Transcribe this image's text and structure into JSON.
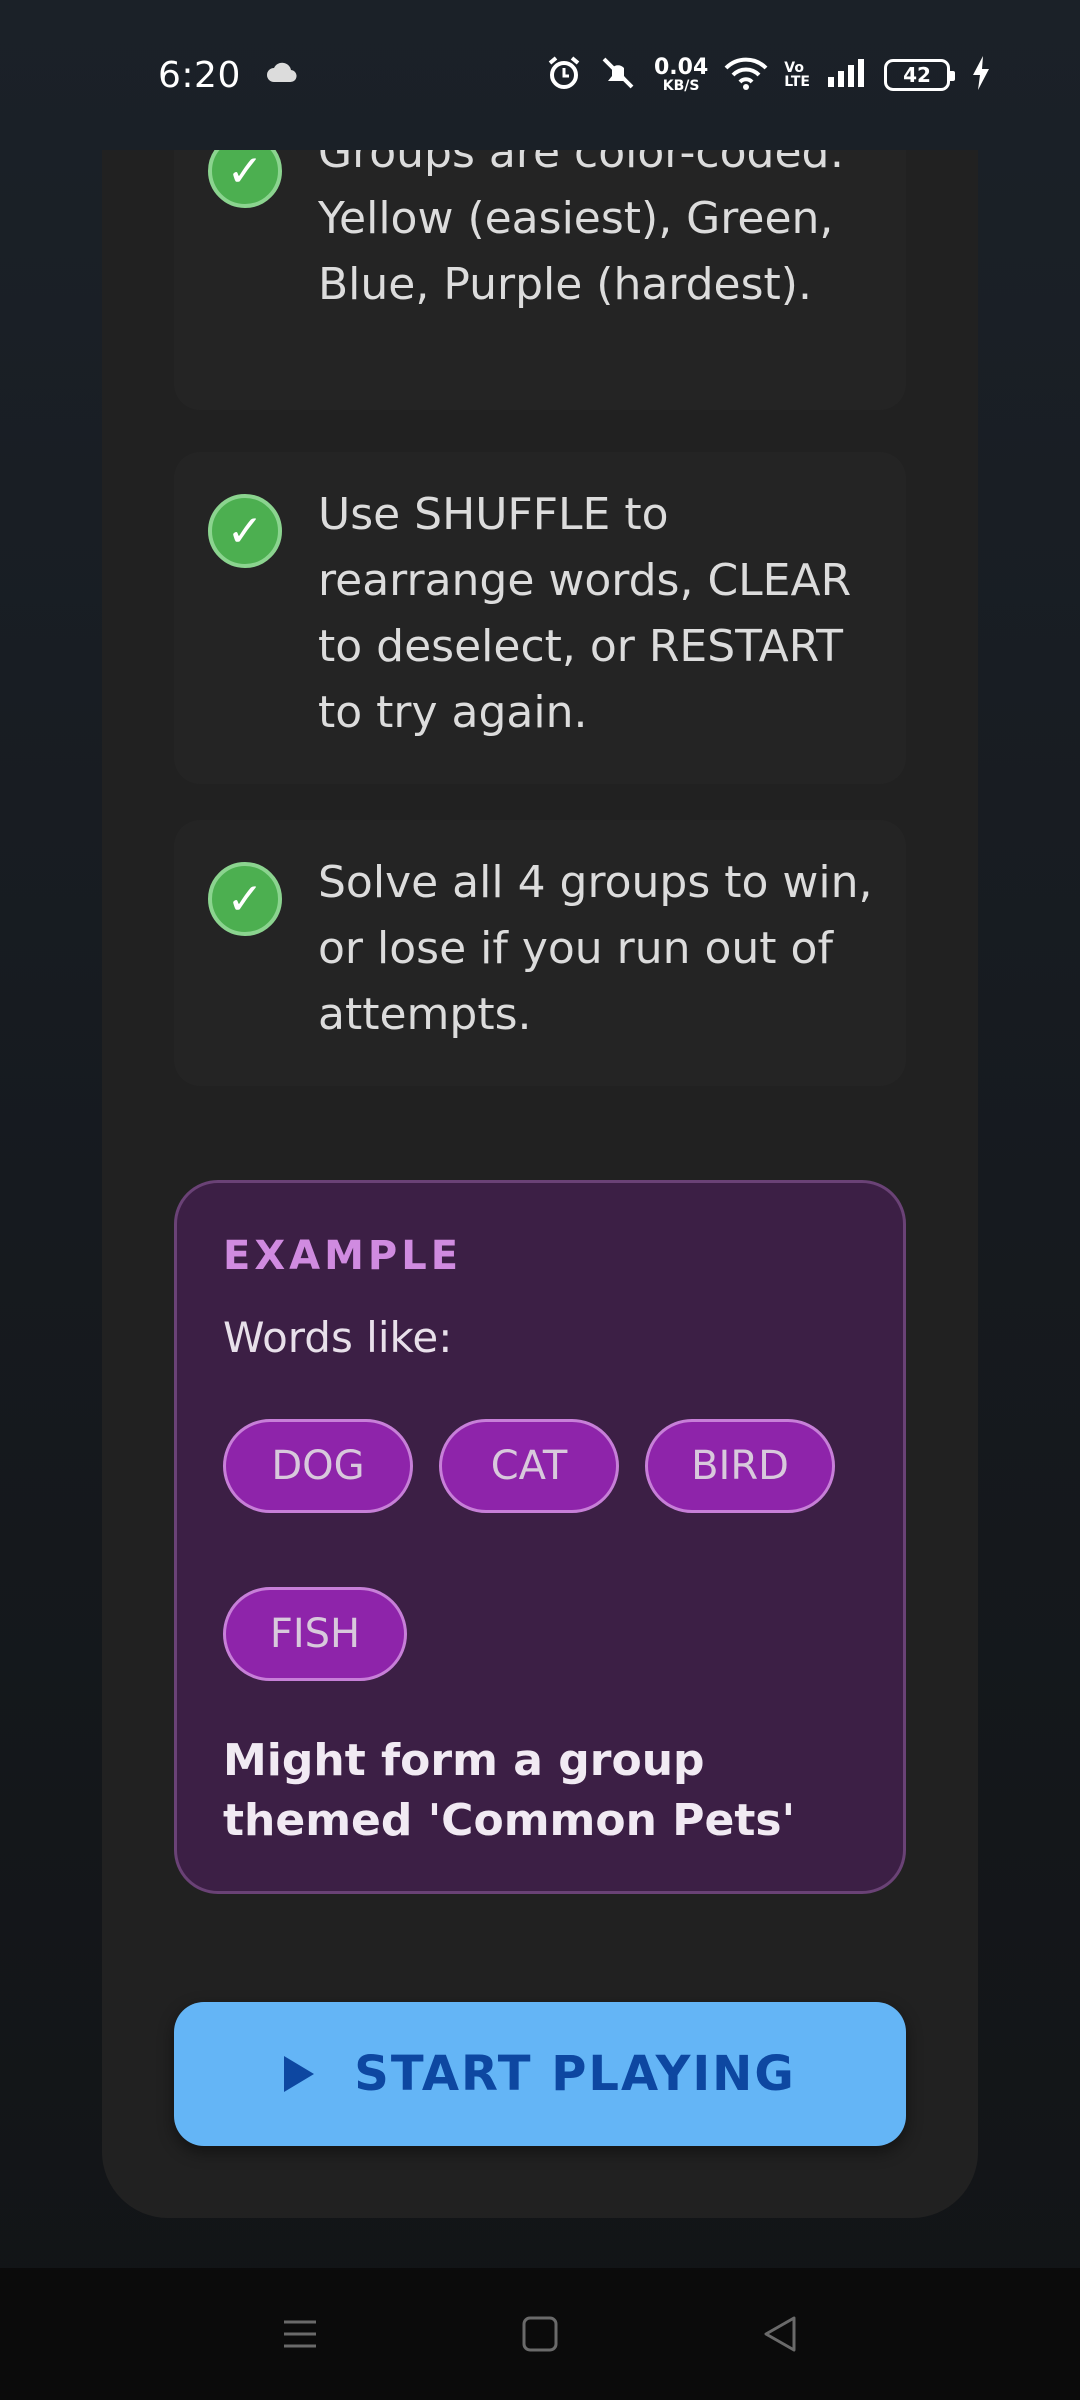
{
  "status_bar": {
    "time": "6:20",
    "net_speed_value": "0.04",
    "net_speed_unit": "KB/S",
    "volte_top": "Vo",
    "volte_bottom": "LTE",
    "battery": "42"
  },
  "rules": [
    {
      "text": "Groups are color-coded: Yellow (easiest), Green, Blue, Purple (hardest)."
    },
    {
      "text": "Use SHUFFLE to rearrange words, CLEAR to deselect, or RESTART to try again."
    },
    {
      "text": "Solve all 4 groups to win, or lose if you run out of attempts."
    }
  ],
  "example": {
    "title": "EXAMPLE",
    "subtitle": "Words like:",
    "words": [
      "DOG",
      "CAT",
      "BIRD",
      "FISH"
    ],
    "note": "Might form a group themed 'Common Pets'"
  },
  "start_button": {
    "label": "START PLAYING"
  },
  "colors": {
    "accent_blue": "#64b5f6",
    "check_green": "#4caf50",
    "chip_purple": "#8e24aa",
    "example_bg": "#3c1f45"
  },
  "icons": [
    "weather-cloud-icon",
    "alarm-icon",
    "mute-icon",
    "wifi-icon",
    "signal-icon",
    "battery-icon",
    "charging-icon",
    "check-icon",
    "play-icon",
    "menu-icon",
    "home-icon",
    "back-icon"
  ]
}
